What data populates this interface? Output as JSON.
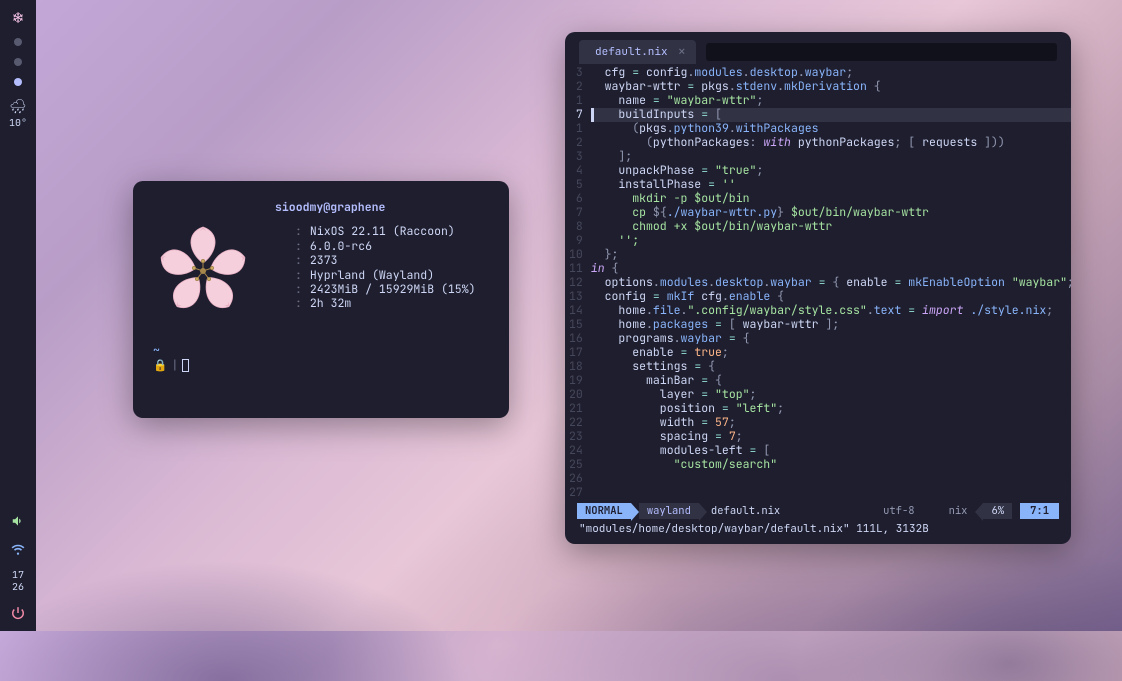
{
  "bar": {
    "weather": {
      "icon": "🌧",
      "temp": "10°"
    },
    "clock": {
      "hour": "17",
      "min": "26"
    }
  },
  "term": {
    "title": "sioodmy@graphene",
    "rows": [
      {
        "ico": "",
        "val": "NixOS 22.11 (Raccoon)"
      },
      {
        "ico": "",
        "val": "6.0.0-rc6"
      },
      {
        "ico": "",
        "val": "2373"
      },
      {
        "ico": "",
        "val": "Hyprland (Wayland)"
      },
      {
        "ico": "",
        "val": "2423MiB / 15929MiB (15%)"
      },
      {
        "ico": "",
        "val": "2h 32m"
      }
    ],
    "prompt_path": "~"
  },
  "editor": {
    "tab": {
      "icon": "",
      "name": "default.nix"
    },
    "status": {
      "mode": "NORMAL",
      "branch_ico": "",
      "branch": "wayland",
      "file": "default.nix",
      "encoding": "utf-8",
      "sep1": "",
      "ft_ico": "",
      "sep2": "",
      "filetype": "nix",
      "percent": "6%",
      "pos": "7:1"
    },
    "footer": "\"modules/home/desktop/waybar/default.nix\" 111L, 3132B",
    "gutter": [
      "3",
      "2",
      "1",
      "7",
      "1",
      "2",
      "3",
      "4",
      "5",
      "6",
      "7",
      "8",
      "9",
      "10",
      "11",
      "12",
      "13",
      "14",
      "15",
      "16",
      "17",
      "18",
      "19",
      "20",
      "21",
      "22",
      "23",
      "24",
      "25",
      "26",
      "27"
    ],
    "code": {
      "l0": {
        "a": "  cfg ",
        "b": "=",
        "c": " config",
        "d": ".",
        "e": "modules",
        "f": ".",
        "g": "desktop",
        "h": ".",
        "i": "waybar",
        "j": ";"
      },
      "l1": {
        "a": "  waybar-wttr ",
        "b": "=",
        "c": " pkgs",
        "d": ".",
        "e": "stdenv",
        "f": ".",
        "g": "mkDerivation ",
        "h": "{"
      },
      "l2": {
        "a": "    name ",
        "b": "=",
        "c": " \"waybar-wttr\"",
        "d": ";"
      },
      "l3": {
        "a": "    buildInputs ",
        "b": "=",
        "c": " ["
      },
      "l4": {
        "a": "      (",
        "b": "pkgs",
        "c": ".",
        "d": "python39",
        "e": ".",
        "f": "withPackages"
      },
      "l5": {
        "a": "        (",
        "b": "pythonPackages",
        "c": ": ",
        "d": "with",
        "e": " pythonPackages",
        "f": "; [ ",
        "g": "requests ",
        "h": "]))"
      },
      "l6": {
        "a": "    ];"
      },
      "l7": {
        "a": "    unpackPhase ",
        "b": "=",
        "c": " \"true\"",
        "d": ";"
      },
      "l8": {
        "a": "    installPhase ",
        "b": "=",
        "c": " ''"
      },
      "l9": {
        "a": "      mkdir -p $out/bin"
      },
      "l10": {
        "a": "      cp ",
        "b": "${",
        "c": "./waybar-wttr.py",
        "d": "}",
        "e": " $out/bin/waybar-wttr"
      },
      "l11": {
        "a": "      chmod +x $out/bin/waybar-wttr"
      },
      "l12": {
        "a": "    '';"
      },
      "l13": {
        "a": "  };"
      },
      "l14": {
        "a": ""
      },
      "l15": {
        "a": "in",
        "b": " {"
      },
      "l16": {
        "a": "  options",
        "b": ".",
        "c": "modules",
        "d": ".",
        "e": "desktop",
        "f": ".",
        "g": "waybar ",
        "h": "=",
        "i": " { ",
        "j": "enable ",
        "k": "=",
        "l": " mkEnableOption ",
        "m": "\"waybar\"",
        "n": "; };"
      },
      "l17": {
        "a": ""
      },
      "l18": {
        "a": "  config ",
        "b": "=",
        "c": " mkIf ",
        "d": "cfg",
        "e": ".",
        "f": "enable ",
        "g": "{"
      },
      "l19": {
        "a": "    home",
        "b": ".",
        "c": "file",
        "d": ".",
        "e": "\".config/waybar/style.css\"",
        "f": ".",
        "g": "text ",
        "h": "=",
        "i": " import ",
        "j": "./style.nix",
        "k": ";"
      },
      "l20": {
        "a": "    home",
        "b": ".",
        "c": "packages ",
        "d": "=",
        "e": " [ ",
        "f": "waybar-wttr ",
        "g": "];"
      },
      "l21": {
        "a": "    programs",
        "b": ".",
        "c": "waybar ",
        "d": "=",
        "e": " {"
      },
      "l22": {
        "a": "      enable ",
        "b": "=",
        "c": " true",
        "d": ";"
      },
      "l23": {
        "a": "      settings ",
        "b": "=",
        "c": " {"
      },
      "l24": {
        "a": "        mainBar ",
        "b": "=",
        "c": " {"
      },
      "l25": {
        "a": "          layer ",
        "b": "=",
        "c": " \"top\"",
        "d": ";"
      },
      "l26": {
        "a": "          position ",
        "b": "=",
        "c": " \"left\"",
        "d": ";"
      },
      "l27": {
        "a": "          width ",
        "b": "=",
        "c": " 57",
        "d": ";"
      },
      "l28": {
        "a": "          spacing ",
        "b": "=",
        "c": " 7",
        "d": ";"
      },
      "l29": {
        "a": "          modules-left ",
        "b": "=",
        "c": " ["
      },
      "l30": {
        "a": "            \"custom/search\""
      }
    }
  }
}
